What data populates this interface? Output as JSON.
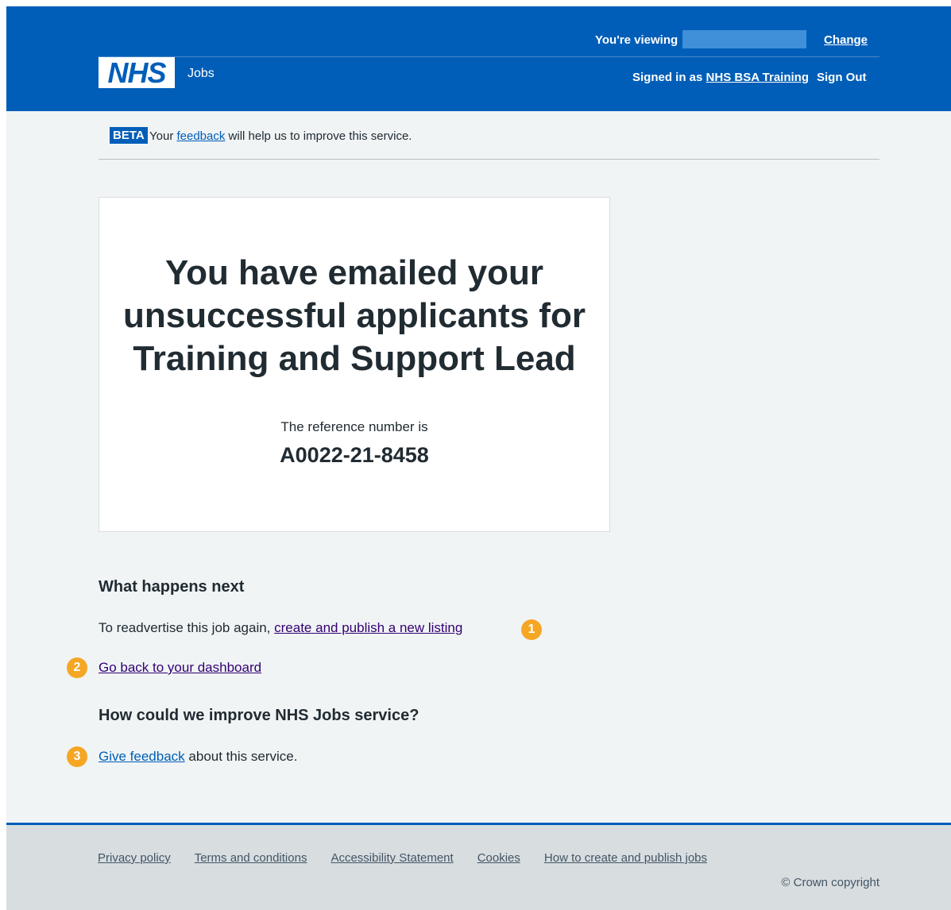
{
  "header": {
    "viewing_label": "You're viewing",
    "change_link": "Change",
    "logo_text": "NHS",
    "service_name": "Jobs",
    "signed_in_prefix": "Signed in as",
    "signed_in_user": "NHS BSA Training",
    "sign_out": "Sign Out"
  },
  "beta": {
    "tag": "BETA",
    "text_before": "Your",
    "link": "feedback",
    "text_after": "will help us to improve this service."
  },
  "confirmation": {
    "title": "You have emailed your unsuccessful applicants for Training and Support Lead",
    "ref_label": "The reference number is",
    "ref_number": "A0022-21-8458"
  },
  "next": {
    "heading": "What happens next",
    "readvertise_text": "To readvertise this job again,",
    "readvertise_link": "create and publish a new listing",
    "dashboard_link": "Go back to your dashboard",
    "improve_heading": "How could we improve NHS Jobs service?",
    "feedback_link": "Give feedback",
    "feedback_after": "about this service."
  },
  "badges": [
    "1",
    "2",
    "3"
  ],
  "footer": {
    "links": [
      "Privacy policy",
      "Terms and conditions",
      "Accessibility Statement",
      "Cookies",
      "How to create and publish jobs"
    ],
    "copyright": "© Crown copyright"
  },
  "colors": {
    "nhs_blue": "#005eb8",
    "background": "#f0f4f5",
    "badge": "#f5a623",
    "visited_link": "#330072"
  }
}
